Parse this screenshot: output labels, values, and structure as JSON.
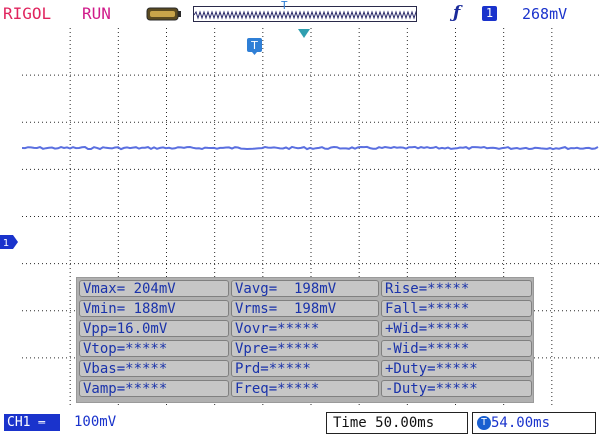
{
  "header": {
    "brand": "RIGOL",
    "run_state": "RUN",
    "timeline_marker": "T",
    "trigger_channel": "1",
    "trigger_level": "268mV"
  },
  "markers": {
    "trigger_position": "T",
    "channel": "1"
  },
  "measurements": [
    [
      "Vmax= 204mV",
      "Vavg=  198mV",
      "Rise=*****"
    ],
    [
      "Vmin= 188mV",
      "Vrms=  198mV",
      "Fall=*****"
    ],
    [
      "Vpp=16.0mV",
      "Vovr=*****",
      "+Wid=*****"
    ],
    [
      "Vtop=*****",
      "Vpre=*****",
      "-Wid=*****"
    ],
    [
      "Vbas=*****",
      "Prd=*****",
      "+Duty=*****"
    ],
    [
      "Vamp=*****",
      "Freq=*****",
      "-Duty=*****"
    ]
  ],
  "footer": {
    "channel_badge": "CH1",
    "channel_scale": "100mV",
    "time_base": "Time 50.00ms",
    "trigger_offset": "54.00ms"
  },
  "colors": {
    "trace": "#5a6fe0",
    "grid": "#2a2a2a",
    "accent": "#1a33cc",
    "brand": "#e0245e",
    "run": "#d01a8a",
    "trigger_marker": "#2f9fb0"
  },
  "icons": [
    "battery-icon",
    "trigger-edge-icon",
    "trigger-position-icon",
    "channel-marker-icon"
  ]
}
